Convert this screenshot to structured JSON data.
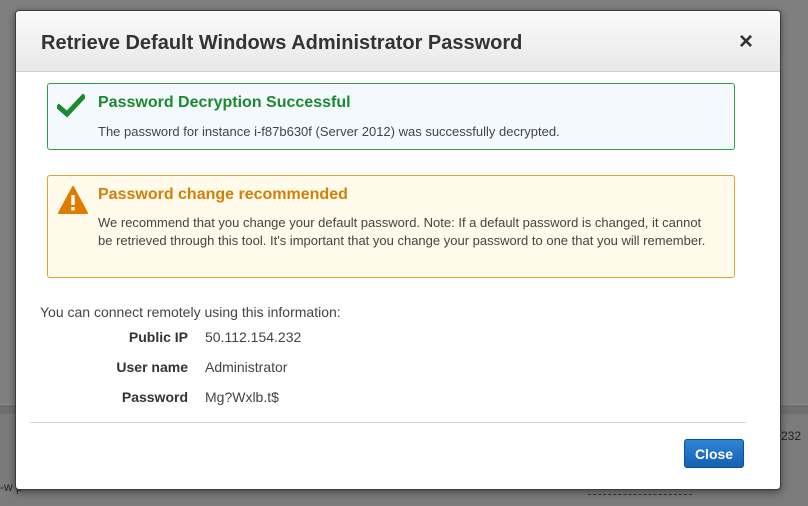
{
  "background": {
    "ip_fragment": "232",
    "left_fragment": "-w         p"
  },
  "dialog": {
    "title": "Retrieve Default Windows Administrator Password",
    "close_icon": "×",
    "success_alert": {
      "icon": "checkmark-icon",
      "title": "Password Decryption Successful",
      "message": "The password for instance i-f87b630f (Server 2012) was successfully decrypted."
    },
    "warning_alert": {
      "icon": "warning-triangle-icon",
      "title": "Password change recommended",
      "message": "We recommend that you change your default password. Note: If a default password is changed, it cannot be retrieved through this tool. It's important that you change your password to one that you will remember."
    },
    "connect_intro": "You can connect remotely using this information:",
    "info": {
      "public_ip_label": "Public IP",
      "public_ip_value": "50.112.154.232",
      "username_label": "User name",
      "username_value": "Administrator",
      "password_label": "Password",
      "password_value": "Mg?Wxlb.t$"
    },
    "close_button_label": "Close"
  },
  "colors": {
    "success": "#1b8a2e",
    "warning": "#d47f07",
    "primary_button": "#1a6fc6"
  }
}
